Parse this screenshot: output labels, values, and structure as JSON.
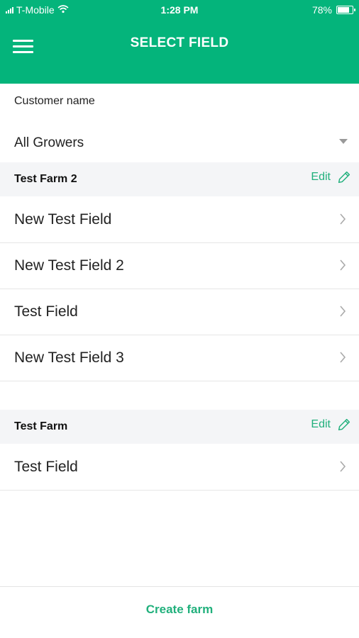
{
  "status_bar": {
    "carrier": "T-Mobile",
    "time": "1:28 PM",
    "battery": "78%",
    "battery_level": 0.78,
    "wifi_icon": "wifi-icon",
    "signal_icon": "signal-icon"
  },
  "header": {
    "title": "SELECT FIELD",
    "menu_icon": "hamburger-menu-icon",
    "background_color": "#04b47b"
  },
  "customer": {
    "label": "Customer name",
    "selected": "All Growers"
  },
  "farms": [
    {
      "name": "Test Farm 2",
      "edit_label": "Edit",
      "fields": [
        "New Test Field",
        "New Test Field 2",
        "Test Field",
        "New Test Field 3"
      ]
    },
    {
      "name": "Test Farm",
      "edit_label": "Edit",
      "fields": [
        "Test Field"
      ]
    }
  ],
  "footer": {
    "create_farm_label": "Create farm"
  },
  "accent_color": "#21b07c"
}
